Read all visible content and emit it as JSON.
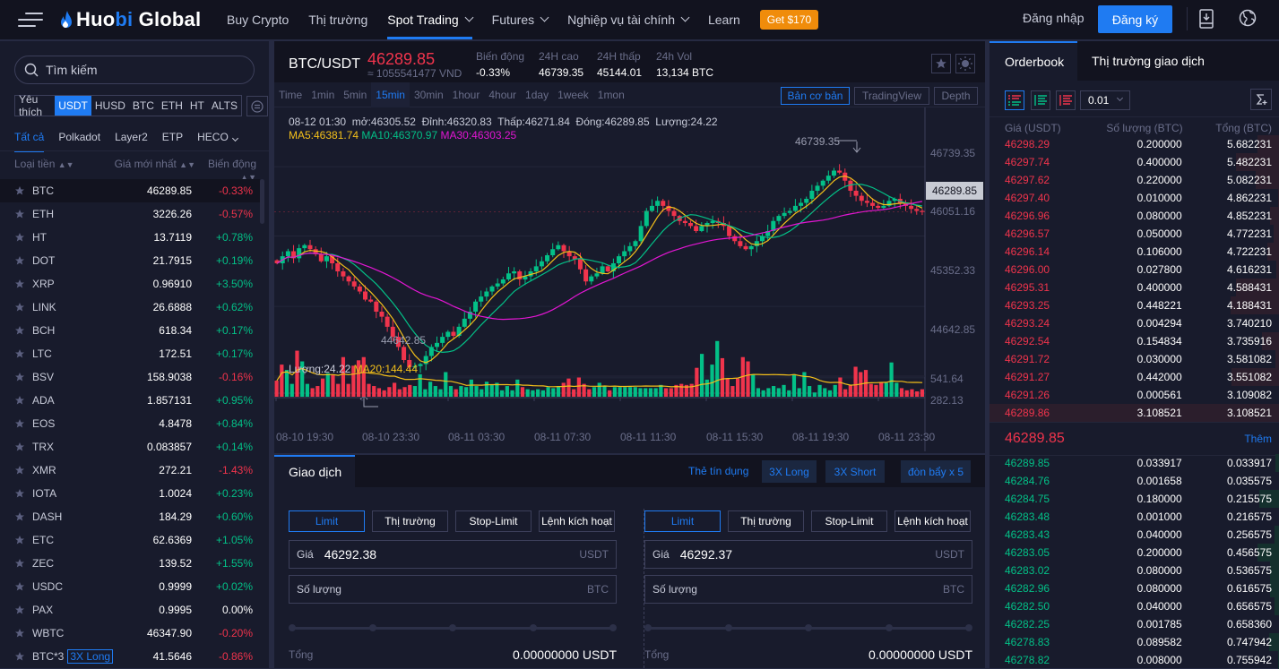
{
  "header": {
    "logo": {
      "prefix": "Huo",
      "highlight": "bi",
      "suffix": " Global"
    },
    "nav": [
      {
        "label": "Buy Crypto",
        "dropdown": false,
        "active": false
      },
      {
        "label": "Thị trường",
        "dropdown": false,
        "active": false
      },
      {
        "label": "Spot Trading",
        "dropdown": true,
        "active": true
      },
      {
        "label": "Futures",
        "dropdown": true,
        "active": false
      },
      {
        "label": "Nghiệp vụ tài chính",
        "dropdown": true,
        "active": false
      },
      {
        "label": "Learn",
        "dropdown": false,
        "active": false
      }
    ],
    "promo": "Get $170",
    "login": "Đăng nhập",
    "signup": "Đăng ký",
    "icons": [
      "download-app-icon",
      "globe-icon"
    ]
  },
  "market_panel": {
    "search_placeholder": "Tìm kiếm",
    "quote_tabs": [
      "Yêu thích",
      "USDT",
      "HUSD",
      "BTC",
      "ETH",
      "HT",
      "ALTS"
    ],
    "active_quote": "USDT",
    "category_tabs": [
      "Tất cả",
      "Polkadot",
      "Layer2",
      "ETP",
      "HECO"
    ],
    "active_category": "Tất cả",
    "columns": {
      "coin": "Loại tiền",
      "price": "Giá mới nhất",
      "change": "Biến động"
    },
    "coins": [
      {
        "symbol": "BTC",
        "price": "46289.85",
        "change": "-0.33%",
        "dir": "dn"
      },
      {
        "symbol": "ETH",
        "price": "3226.26",
        "change": "-0.57%",
        "dir": "dn"
      },
      {
        "symbol": "HT",
        "price": "13.7119",
        "change": "+0.78%",
        "dir": "up"
      },
      {
        "symbol": "DOT",
        "price": "21.7915",
        "change": "+0.19%",
        "dir": "up"
      },
      {
        "symbol": "XRP",
        "price": "0.96910",
        "change": "+3.50%",
        "dir": "up"
      },
      {
        "symbol": "LINK",
        "price": "26.6888",
        "change": "+0.62%",
        "dir": "up"
      },
      {
        "symbol": "BCH",
        "price": "618.34",
        "change": "+0.17%",
        "dir": "up"
      },
      {
        "symbol": "LTC",
        "price": "172.51",
        "change": "+0.17%",
        "dir": "up"
      },
      {
        "symbol": "BSV",
        "price": "158.9038",
        "change": "-0.16%",
        "dir": "dn"
      },
      {
        "symbol": "ADA",
        "price": "1.857131",
        "change": "+0.95%",
        "dir": "up"
      },
      {
        "symbol": "EOS",
        "price": "4.8478",
        "change": "+0.84%",
        "dir": "up"
      },
      {
        "symbol": "TRX",
        "price": "0.083857",
        "change": "+0.14%",
        "dir": "up"
      },
      {
        "symbol": "XMR",
        "price": "272.21",
        "change": "-1.43%",
        "dir": "dn"
      },
      {
        "symbol": "IOTA",
        "price": "1.0024",
        "change": "+0.23%",
        "dir": "up"
      },
      {
        "symbol": "DASH",
        "price": "184.29",
        "change": "+0.60%",
        "dir": "up"
      },
      {
        "symbol": "ETC",
        "price": "62.6369",
        "change": "+1.05%",
        "dir": "up"
      },
      {
        "symbol": "ZEC",
        "price": "139.52",
        "change": "+1.55%",
        "dir": "up"
      },
      {
        "symbol": "USDC",
        "price": "0.9999",
        "change": "+0.02%",
        "dir": "up"
      },
      {
        "symbol": "PAX",
        "price": "0.9995",
        "change": "0.00%",
        "dir": "flat"
      },
      {
        "symbol": "WBTC",
        "price": "46347.90",
        "change": "-0.20%",
        "dir": "dn"
      },
      {
        "symbol": "BTC*3",
        "tag": "3X Long",
        "price": "41.5646",
        "change": "-0.86%",
        "dir": "dn"
      }
    ]
  },
  "ticker": {
    "pair": "BTC/USDT",
    "last": "46289.85",
    "fiat": "≈ 1055541477 VND",
    "stats": [
      {
        "label": "Biến động",
        "value": "-0.33%",
        "color": "#f0344c"
      },
      {
        "label": "24H cao",
        "value": "46739.35"
      },
      {
        "label": "24H thấp",
        "value": "45144.01"
      },
      {
        "label": "24h Vol",
        "value": "13,134 BTC"
      }
    ]
  },
  "chart_toolbar": {
    "periods": [
      "Time",
      "1min",
      "5min",
      "15min",
      "30min",
      "1hour",
      "4hour",
      "1day",
      "1week",
      "1mon"
    ],
    "active_period": "15min",
    "views": [
      "Bản cơ bản",
      "TradingView",
      "Depth"
    ],
    "active_view": "Bản cơ bản"
  },
  "chart_data": {
    "type": "candlestick",
    "title": "BTC/USDT 15min",
    "ohlc_readout": "08-12 01:30  mở:46305.52  Đỉnh:46320.83  Thấp:46271.84  Đóng:46289.85  Lượng:24.22",
    "ma_readout": [
      {
        "label": "MA5:46381.74",
        "color": "#f4c01a"
      },
      {
        "label": "MA10:46370.97",
        "color": "#03c087"
      },
      {
        "label": "MA30:46303.25",
        "color": "#e316d3"
      }
    ],
    "price_ticks": [
      "46739.35",
      "46051.16",
      "45352.33",
      "44642.85"
    ],
    "current_price": "46289.85",
    "high_marker": "46739.35",
    "low_marker": "44642.85",
    "ylim": [
      44500,
      46900
    ],
    "volume_label": "Lượng:24.22",
    "volume_ma": "MA20:144.44",
    "volume_ticks": [
      "541.64",
      "282.13"
    ],
    "x_ticks": [
      "08-10 19:30",
      "08-10 23:30",
      "08-11 03:30",
      "08-11 07:30",
      "08-11 11:30",
      "08-11 15:30",
      "08-11 19:30",
      "08-11 23:30"
    ],
    "close_path": [
      45780,
      45850,
      45900,
      45830,
      45930,
      45960,
      45920,
      45870,
      45800,
      45850,
      45780,
      45700,
      45650,
      45600,
      45550,
      45500,
      45420,
      45400,
      45300,
      45250,
      45150,
      45050,
      44950,
      44820,
      44750,
      44760,
      44780,
      44860,
      44950,
      44990,
      45050,
      45100,
      45060,
      45150,
      45230,
      45300,
      45400,
      45450,
      45500,
      45550,
      45580,
      45620,
      45680,
      45700,
      45620,
      45650,
      45700,
      45750,
      45800,
      45860,
      45920,
      45960,
      45900,
      45850,
      45820,
      45720,
      45600,
      45650,
      45680,
      45750,
      45700,
      45780,
      45850,
      45900,
      45950,
      46000,
      46150,
      46300,
      46350,
      46400,
      46350,
      46300,
      46250,
      46200,
      46180,
      46150,
      46100,
      46150,
      46180,
      46200,
      46180,
      46150,
      46050,
      46000,
      45950,
      45920,
      45950,
      46000,
      46050,
      46100,
      46200,
      46250,
      46280,
      46300,
      46350,
      46380,
      46420,
      46500,
      46550,
      46600,
      46650,
      46700,
      46680,
      46600,
      46500,
      46450,
      46400,
      46380,
      46350,
      46330,
      46350,
      46400,
      46420,
      46380,
      46350,
      46320,
      46300,
      46290
    ],
    "volumes": [
      150,
      300,
      250,
      120,
      430,
      330,
      120,
      80,
      100,
      170,
      220,
      210,
      120,
      370,
      120,
      290,
      340,
      370,
      120,
      100,
      80,
      60,
      90,
      130,
      70,
      90,
      110,
      100,
      210,
      70,
      140,
      100,
      70,
      230,
      100,
      70,
      100,
      90,
      160,
      100,
      70,
      140,
      110,
      130,
      60,
      100,
      60,
      160,
      90,
      70,
      60,
      70,
      60,
      90,
      80,
      100,
      130,
      170,
      70,
      180,
      120,
      70,
      90,
      130,
      100,
      60,
      90,
      90,
      90,
      90,
      90,
      80,
      80,
      80,
      80,
      110,
      80,
      80,
      110,
      120,
      110,
      120,
      270,
      400,
      160,
      300,
      520,
      360,
      170,
      100,
      170,
      370,
      330,
      210,
      80,
      60,
      80,
      100,
      80,
      110,
      60,
      210,
      80,
      230,
      100,
      40,
      110,
      80,
      60,
      110,
      180,
      70,
      110,
      280,
      230,
      250,
      120,
      110,
      130,
      130,
      320,
      130,
      80,
      60,
      70,
      50,
      70
    ]
  },
  "trade": {
    "tab": "Giao dịch",
    "links": [
      "Thẻ tín dụng",
      "3X Long",
      "3X Short",
      "đòn bẩy x 5"
    ],
    "order_types": [
      "Limit",
      "Thị trường",
      "Stop-Limit",
      "Lệnh kích hoạt"
    ],
    "buy": {
      "price_label": "Giá",
      "price": "46292.38",
      "price_unit": "USDT",
      "amount_label": "Số lượng",
      "amount_unit": "BTC",
      "total_label": "Tổng",
      "total": "0.00000000 USDT",
      "slider_value": 0
    },
    "sell": {
      "price_label": "Giá",
      "price": "46292.37",
      "price_unit": "USDT",
      "amount_label": "Số lượng",
      "amount_unit": "BTC",
      "total_label": "Tổng",
      "total": "0.00000000 USDT",
      "slider_value": 0
    }
  },
  "orderbook": {
    "tabs": [
      "Orderbook",
      "Thị trường giao dịch"
    ],
    "precision": "0.01",
    "columns": [
      "Giá (USDT)",
      "Số lượng (BTC)",
      "Tổng (BTC)"
    ],
    "asks": [
      [
        "46298.29",
        "0.200000",
        "5.682231"
      ],
      [
        "46297.74",
        "0.400000",
        "5.482231"
      ],
      [
        "46297.62",
        "0.220000",
        "5.082231"
      ],
      [
        "46297.40",
        "0.010000",
        "4.862231"
      ],
      [
        "46296.96",
        "0.080000",
        "4.852231"
      ],
      [
        "46296.57",
        "0.050000",
        "4.772231"
      ],
      [
        "46296.14",
        "0.106000",
        "4.722231"
      ],
      [
        "46296.00",
        "0.027800",
        "4.616231"
      ],
      [
        "46295.31",
        "0.400000",
        "4.588431"
      ],
      [
        "46293.25",
        "0.448221",
        "4.188431"
      ],
      [
        "46293.24",
        "0.004294",
        "3.740210"
      ],
      [
        "46292.54",
        "0.154834",
        "3.735916"
      ],
      [
        "46291.72",
        "0.030000",
        "3.581082"
      ],
      [
        "46291.27",
        "0.442000",
        "3.551082"
      ],
      [
        "46291.26",
        "0.000561",
        "3.109082"
      ],
      [
        "46289.86",
        "3.108521",
        "3.108521"
      ]
    ],
    "mid_price": "46289.85",
    "more": "Thêm",
    "bids": [
      [
        "46289.85",
        "0.033917",
        "0.033917"
      ],
      [
        "46284.76",
        "0.001658",
        "0.035575"
      ],
      [
        "46284.75",
        "0.180000",
        "0.215575"
      ],
      [
        "46283.48",
        "0.001000",
        "0.216575"
      ],
      [
        "46283.43",
        "0.040000",
        "0.256575"
      ],
      [
        "46283.05",
        "0.200000",
        "0.456575"
      ],
      [
        "46283.02",
        "0.080000",
        "0.536575"
      ],
      [
        "46282.96",
        "0.080000",
        "0.616575"
      ],
      [
        "46282.50",
        "0.040000",
        "0.656575"
      ],
      [
        "46282.25",
        "0.001785",
        "0.658360"
      ],
      [
        "46278.83",
        "0.089582",
        "0.747942"
      ],
      [
        "46278.82",
        "0.008000",
        "0.755942"
      ]
    ]
  }
}
